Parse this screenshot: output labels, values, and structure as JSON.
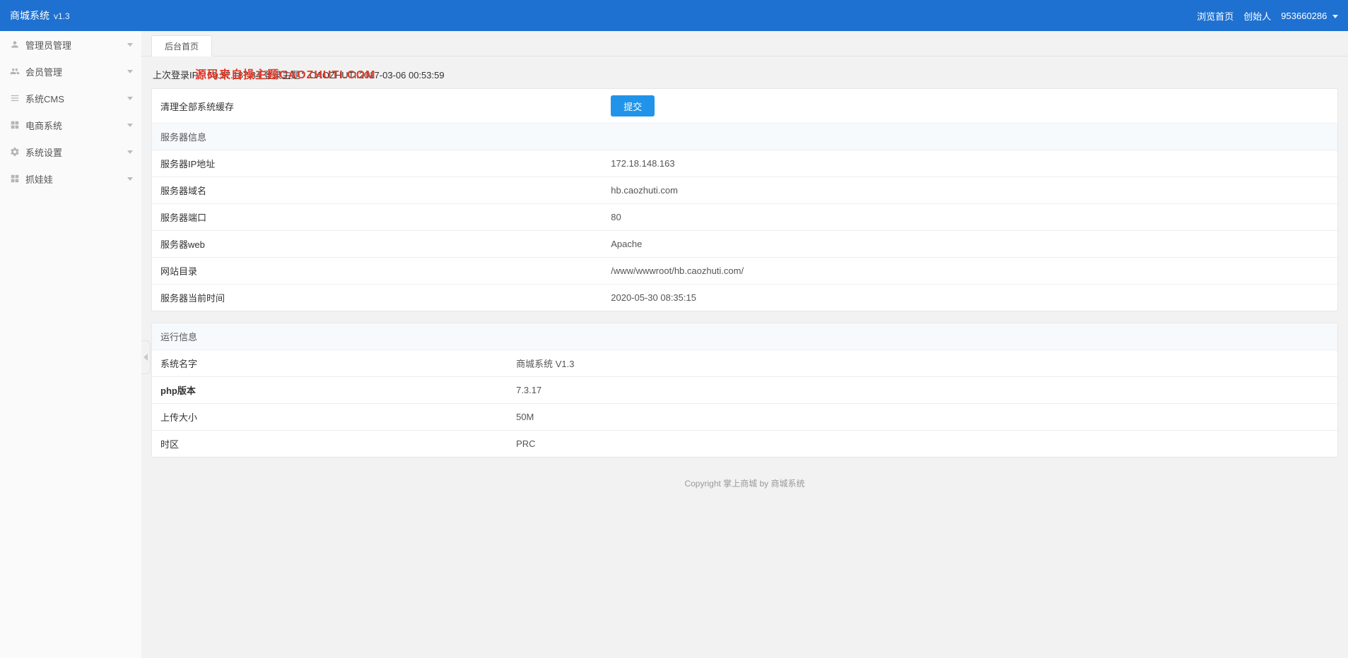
{
  "header": {
    "title": "商城系统",
    "version": "v1.3",
    "browse_home": "浏览首页",
    "founder_label": "创始人",
    "account_id": "953660286"
  },
  "sidebar": {
    "items": [
      {
        "icon": "user",
        "label": "管理员管理"
      },
      {
        "icon": "users",
        "label": "会员管理"
      },
      {
        "icon": "list",
        "label": "系统CMS"
      },
      {
        "icon": "grid",
        "label": "电商系统"
      },
      {
        "icon": "gear",
        "label": "系统设置"
      },
      {
        "icon": "grid",
        "label": "抓娃娃"
      }
    ]
  },
  "tabs": [
    {
      "label": "后台首页"
    }
  ],
  "last_login_line": "上次登录IP：59.37.187.84 登录主题：CAOZHUTI.2017-03-06 00:53:59",
  "watermark": "源码来自操主题CAOZHUTI.COM",
  "cache_clear": {
    "label": "清理全部系统缓存",
    "submit": "提交"
  },
  "server_info": {
    "heading": "服务器信息",
    "rows": [
      {
        "label": "服务器IP地址",
        "value": "172.18.148.163"
      },
      {
        "label": "服务器域名",
        "value": "hb.caozhuti.com"
      },
      {
        "label": "服务器端口",
        "value": "80"
      },
      {
        "label": "服务器web",
        "value": "Apache"
      },
      {
        "label": "网站目录",
        "value": "/www/wwwroot/hb.caozhuti.com/"
      },
      {
        "label": "服务器当前时间",
        "value": "2020-05-30 08:35:15"
      }
    ]
  },
  "runtime_info": {
    "heading": "运行信息",
    "rows": [
      {
        "label": "系统名字",
        "value": "商城系统 V1.3"
      },
      {
        "label": "php版本",
        "value": "7.3.17"
      },
      {
        "label": "上传大小",
        "value": "50M"
      },
      {
        "label": "时区",
        "value": "PRC"
      }
    ]
  },
  "footer": "Copyright 掌上商城 by 商城系统"
}
